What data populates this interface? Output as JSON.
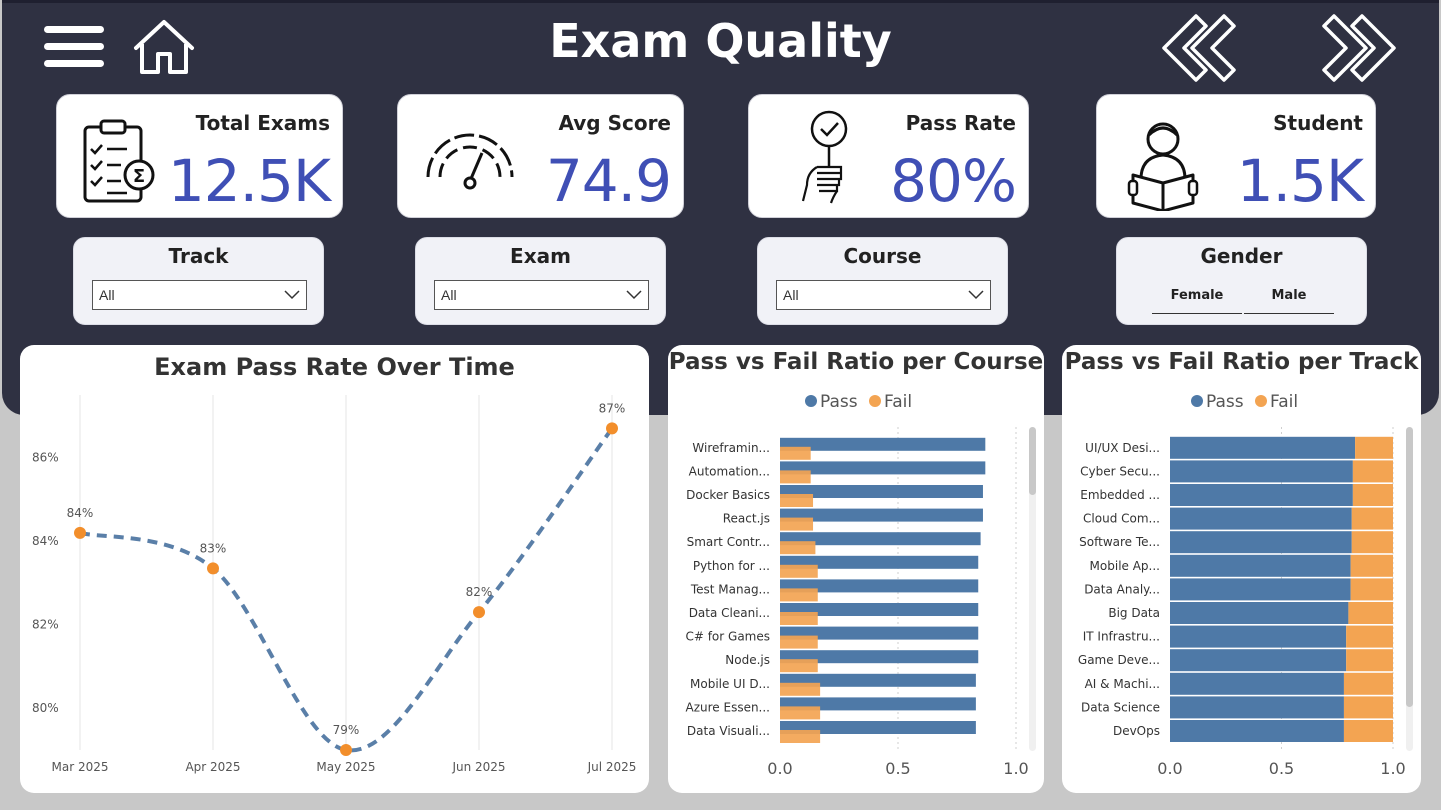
{
  "header": {
    "title": "Exam Quality"
  },
  "kpis": [
    {
      "label": "Total Exams",
      "value": "12.5K",
      "icon": "clipboard-sigma-icon"
    },
    {
      "label": "Avg Score",
      "value": "74.9",
      "icon": "gauge-icon"
    },
    {
      "label": "Pass Rate",
      "value": "80%",
      "icon": "hand-check-icon"
    },
    {
      "label": "Student",
      "value": "1.5K",
      "icon": "student-reading-icon"
    }
  ],
  "filters": {
    "track": {
      "label": "Track",
      "value": "All"
    },
    "exam": {
      "label": "Exam",
      "value": "All"
    },
    "course": {
      "label": "Course",
      "value": "All"
    },
    "gender": {
      "label": "Gender",
      "options": [
        "Female",
        "Male"
      ]
    }
  },
  "colors": {
    "header": "#2f3142",
    "kpi_value": "#3f4fb5",
    "pass": "#4e79a7",
    "fail": "#f3a452",
    "line": "#5a7fa8",
    "marker": "#f28e2b"
  },
  "chart_data": [
    {
      "type": "line",
      "title": "Exam Pass Rate Over Time",
      "x": [
        "Mar 2025",
        "Apr 2025",
        "May 2025",
        "Jun 2025",
        "Jul 2025"
      ],
      "values": [
        84.2,
        83.35,
        79.0,
        82.3,
        86.7
      ],
      "data_labels": [
        "84%",
        "83%",
        "79%",
        "82%",
        "87%"
      ],
      "y_ticks": [
        "80%",
        "82%",
        "84%",
        "86%"
      ],
      "y_tick_values": [
        80,
        82,
        84,
        86
      ],
      "ylim": [
        79.0,
        87.5
      ],
      "line_style": "dashed",
      "grid": "vertical"
    },
    {
      "type": "bar",
      "title": "Pass vs Fail Ratio per Course",
      "orientation": "horizontal",
      "categories": [
        "Wireframin...",
        "Automation...",
        "Docker Basics",
        "React.js",
        "Smart Contr...",
        "Python for ...",
        "Test Manag...",
        "Data Cleani...",
        "C# for Games",
        "Node.js",
        "Mobile UI D...",
        "Azure Essen...",
        "Data Visuali..."
      ],
      "series": [
        {
          "name": "Pass",
          "values": [
            0.87,
            0.87,
            0.86,
            0.86,
            0.85,
            0.84,
            0.84,
            0.84,
            0.84,
            0.84,
            0.83,
            0.83,
            0.83
          ]
        },
        {
          "name": "Fail",
          "values": [
            0.13,
            0.13,
            0.14,
            0.14,
            0.15,
            0.16,
            0.16,
            0.16,
            0.16,
            0.16,
            0.17,
            0.17,
            0.17
          ]
        }
      ],
      "x_ticks": [
        "0.0",
        "0.5",
        "1.0"
      ],
      "xlim": [
        0,
        1
      ],
      "legend": "top"
    },
    {
      "type": "bar",
      "title": "Pass vs Fail Ratio per Track",
      "orientation": "horizontal",
      "stacked": true,
      "categories": [
        "UI/UX Desi...",
        "Cyber Secu...",
        "Embedded ...",
        "Cloud Com...",
        "Software Te...",
        "Mobile Ap...",
        "Data Analy...",
        "Big Data",
        "IT Infrastru...",
        "Game Deve...",
        "AI & Machi...",
        "Data Science",
        "DevOps"
      ],
      "series": [
        {
          "name": "Pass",
          "values": [
            0.83,
            0.82,
            0.82,
            0.815,
            0.815,
            0.81,
            0.81,
            0.8,
            0.79,
            0.79,
            0.78,
            0.78,
            0.78
          ]
        },
        {
          "name": "Fail",
          "values": [
            0.17,
            0.18,
            0.18,
            0.185,
            0.185,
            0.19,
            0.19,
            0.2,
            0.21,
            0.21,
            0.22,
            0.22,
            0.22
          ]
        }
      ],
      "x_ticks": [
        "0.0",
        "0.5",
        "1.0"
      ],
      "xlim": [
        0,
        1
      ],
      "legend": "top"
    }
  ]
}
